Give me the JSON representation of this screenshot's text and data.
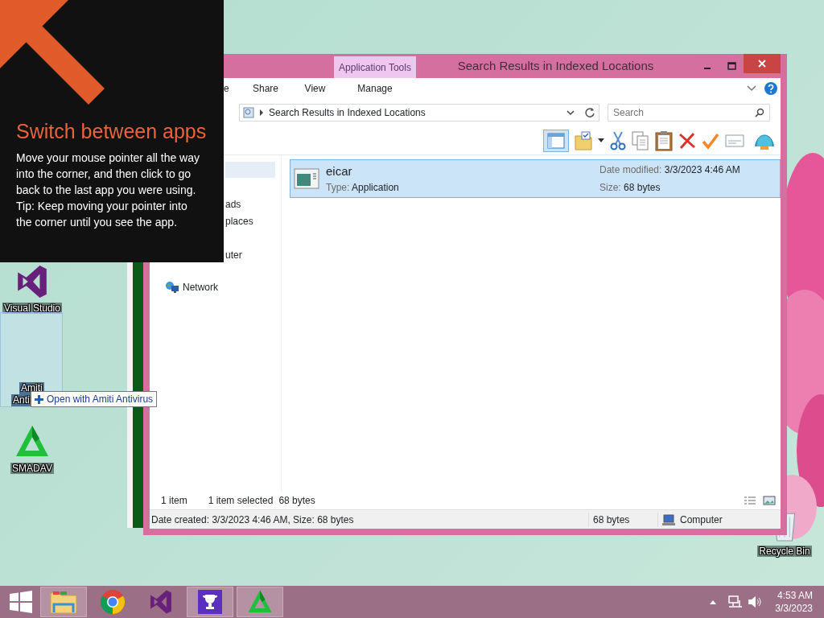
{
  "tip": {
    "title": "Switch between apps",
    "paragraphs": [
      "Move your mouse pointer all the way into the corner, and then click to go back to the last app you were using.",
      "Tip: Keep moving your pointer into the corner until you see the app."
    ]
  },
  "desktop_icons": [
    {
      "kind": "vs",
      "label": "Visual Studio"
    },
    {
      "kind": "smadav",
      "label": "SMADAV"
    },
    {
      "kind": "bin",
      "label": "Recycle Bin"
    }
  ],
  "drag_ghost": {
    "label_lines": [
      "Amiti",
      "Anti"
    ]
  },
  "drop_tooltip": {
    "text": "Open with Amiti Antivirus"
  },
  "explorer": {
    "title": "Search Results in Indexed Locations",
    "context_tab_group": "Application Tools",
    "ribbon_tabs": [
      {
        "label": "e",
        "selected": false
      },
      {
        "label": "Share",
        "selected": false
      },
      {
        "label": "View",
        "selected": false
      },
      {
        "label": "Manage",
        "selected": false
      }
    ],
    "address": "Search Results in Indexed Locations",
    "search": {
      "placeholder": "Search"
    },
    "nav_items": [
      {
        "label": "ads",
        "kind": "text"
      },
      {
        "label": "places",
        "kind": "text"
      },
      {
        "label": "uter",
        "kind": "text"
      },
      {
        "label": "Network",
        "kind": "network"
      }
    ],
    "files": [
      {
        "name": "eicar",
        "type_label": "Type:",
        "type": "Application",
        "date_label": "Date modified:",
        "date": "3/3/2023 4:46 AM",
        "size_label": "Size:",
        "size": "68 bytes",
        "selected": true
      }
    ],
    "status": {
      "count": "1 item",
      "selection": "1 item selected",
      "selection_size": "68 bytes"
    },
    "details_bar": {
      "summary": "Date created: 3/3/2023 4:46 AM, Size: 68 bytes",
      "size": "68 bytes",
      "location": "Computer"
    }
  },
  "taskbar": {
    "items": [
      {
        "kind": "start",
        "active": false
      },
      {
        "kind": "explorer",
        "active": true
      },
      {
        "kind": "chrome",
        "active": false
      },
      {
        "kind": "vs",
        "active": false
      },
      {
        "kind": "trophy",
        "active": true
      },
      {
        "kind": "smadav",
        "active": true
      }
    ],
    "clock": {
      "time": "4:53 AM",
      "date": "3/3/2023"
    }
  }
}
